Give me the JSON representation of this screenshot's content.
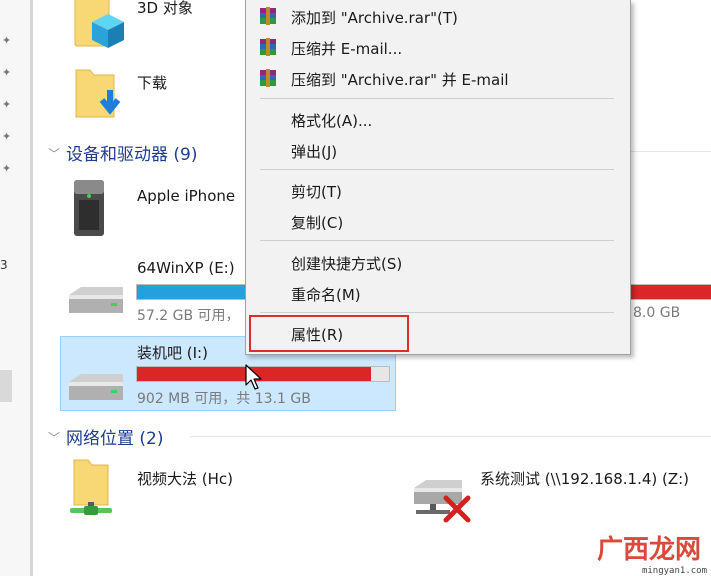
{
  "left_pane": {
    "partial_char": "3"
  },
  "folders": {
    "objects3d": {
      "label": "3D 对象"
    },
    "downloads": {
      "label": "下载"
    }
  },
  "groups": {
    "devices": {
      "header": "设备和驱动器 (9)"
    },
    "network": {
      "header": "网络位置 (2)"
    }
  },
  "devices": {
    "iphone": {
      "label": "Apple iPhone"
    },
    "winxp": {
      "label": "64WinXP (E:)",
      "sub": "57.2 GB 可用，",
      "usage": 0.47
    },
    "hidden_drive": {
      "sub_tail": "8.0 GB",
      "usage": 0.95
    },
    "zhuangjiba": {
      "label": "装机吧 (I:)",
      "sub": "902 MB 可用，共 13.1 GB",
      "usage": 0.93
    }
  },
  "network": {
    "video": {
      "label": "视频大法 (Hc)"
    },
    "test": {
      "label": "系统测试 (\\\\192.168.1.4) (Z:)"
    }
  },
  "context_menu": {
    "add_archive": "添加到 \"Archive.rar\"(T)",
    "compress_email": "压缩并 E-mail...",
    "compress_to_email": "压缩到 \"Archive.rar\" 并 E-mail",
    "format": "格式化(A)...",
    "eject": "弹出(J)",
    "cut": "剪切(T)",
    "copy": "复制(C)",
    "shortcut": "创建快捷方式(S)",
    "rename": "重命名(M)",
    "properties": "属性(R)"
  },
  "colors": {
    "accent_blue": "#26a0da",
    "drive_full_red": "#da2626",
    "highlight_red": "#d9302c",
    "selection_bg": "#cce8ff"
  },
  "watermark": {
    "text": "广西龙网",
    "url": "mingyan1.com"
  }
}
